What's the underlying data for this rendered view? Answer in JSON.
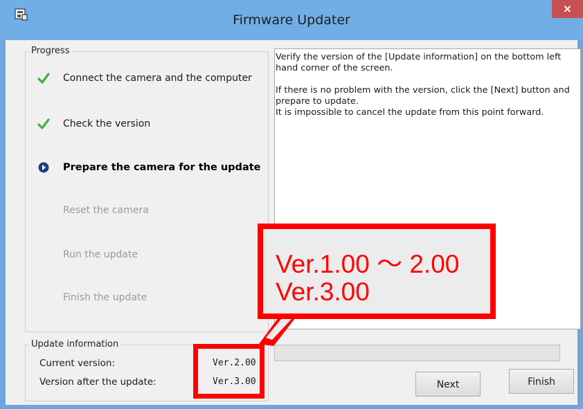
{
  "window": {
    "title": "Firmware Updater",
    "close_glyph": "×"
  },
  "progress": {
    "legend": "Progress",
    "steps": [
      {
        "label": "Connect the camera and the computer",
        "state": "done",
        "icon": "check-icon"
      },
      {
        "label": "Check the version",
        "state": "done",
        "icon": "check-icon"
      },
      {
        "label": "Prepare the camera for the update",
        "state": "current",
        "icon": "arrow-right-circle-icon"
      },
      {
        "label": "Reset the camera",
        "state": "pending",
        "icon": ""
      },
      {
        "label": "Run the update",
        "state": "pending",
        "icon": ""
      },
      {
        "label": "Finish the update",
        "state": "pending",
        "icon": ""
      }
    ]
  },
  "update_info": {
    "legend": "Update information",
    "current_label": "Current version:",
    "current_value": "Ver.2.00",
    "after_label": "Version after the update:",
    "after_value": "Ver.3.00"
  },
  "message": {
    "line1": "Verify the version of the [Update information] on the bottom left hand corner of the screen.",
    "line2": "If there is no problem with the version, click the [Next] button and prepare to update.",
    "line3": "It is impossible to cancel the update from this point forward."
  },
  "progress_bar": {
    "fraction": 0
  },
  "buttons": {
    "next": "Next",
    "finish": "Finish"
  },
  "annotation": {
    "line1": "Ver.1.00 ～ 2.00",
    "line2": "Ver.3.00",
    "color": "#ff0000"
  },
  "colors": {
    "check": "#3cb043",
    "current_arrow": "#1f3f7a",
    "titlebar": "#72aee6"
  }
}
